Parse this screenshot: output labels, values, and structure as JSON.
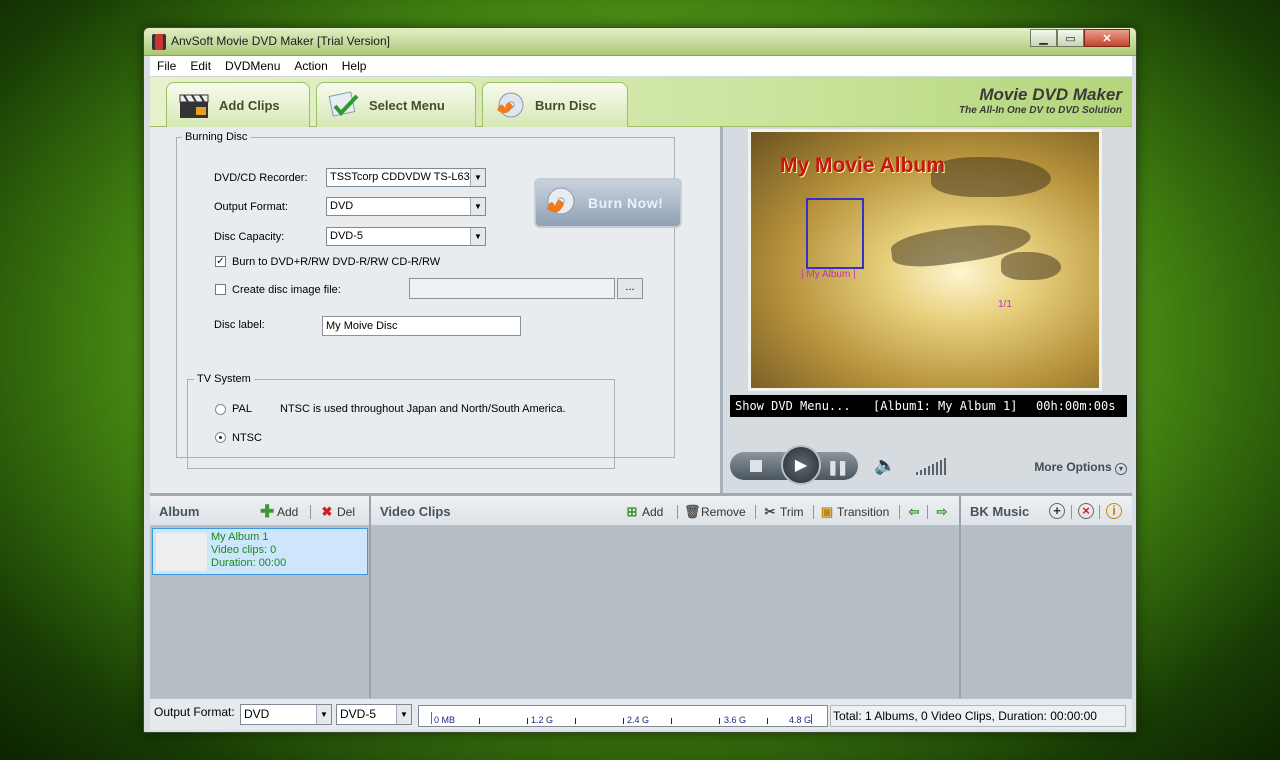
{
  "window": {
    "title": "AnvSoft Movie DVD Maker [Trial Version]"
  },
  "menu": [
    "File",
    "Edit",
    "DVDMenu",
    "Action",
    "Help"
  ],
  "tabs": [
    "Add Clips",
    "Select Menu",
    "Burn Disc"
  ],
  "brand": {
    "name": "Movie DVD Maker",
    "tagline": "The All-In One DV to DVD Solution"
  },
  "burning": {
    "group_label": "Burning Disc",
    "recorder_label": "DVD/CD Recorder:",
    "recorder_value": "TSSTcorp CDDVDW TS-L63",
    "format_label": "Output Format:",
    "format_value": "DVD",
    "capacity_label": "Disc Capacity:",
    "capacity_value": "DVD-5",
    "burn_to_label": "Burn to DVD+R/RW DVD-R/RW  CD-R/RW",
    "burn_to_checked": true,
    "image_label": "Create disc image file:",
    "image_checked": false,
    "browse_label": "...",
    "disc_label_label": "Disc label:",
    "disc_label_value": "My Moive Disc",
    "burn_now": "Burn Now!",
    "tv_label": "TV System",
    "pal": "PAL",
    "ntsc": "NTSC",
    "tv_selected": "NTSC",
    "tv_note": "NTSC is used throughout Japan and North/South America."
  },
  "preview": {
    "title": "My Movie Album",
    "caption": "My Album",
    "page": "1/1",
    "status_left": "Show DVD Menu...",
    "status_mid": "[Album1: My Album 1]",
    "status_time": "00h:00m:00s",
    "more_options": "More Options"
  },
  "album": {
    "title": "Album",
    "add": "Add",
    "del": "Del",
    "item": {
      "name": "My Album 1",
      "clips": "Video clips: 0",
      "duration": "Duration: 00:00"
    }
  },
  "clips": {
    "title": "Video Clips",
    "add": "Add",
    "remove": "Remove",
    "trim": "Trim",
    "transition": "Transition"
  },
  "music": {
    "title": "BK Music"
  },
  "footer": {
    "format_label": "Output Format:",
    "format_value": "DVD",
    "capacity_value": "DVD-5",
    "meter_labels": [
      "0 MB",
      "1.2 G",
      "2.4 G",
      "3.6 G",
      "4.8 G"
    ],
    "totals": "Total: 1 Albums, 0 Video Clips, Duration: 00:00:00"
  }
}
